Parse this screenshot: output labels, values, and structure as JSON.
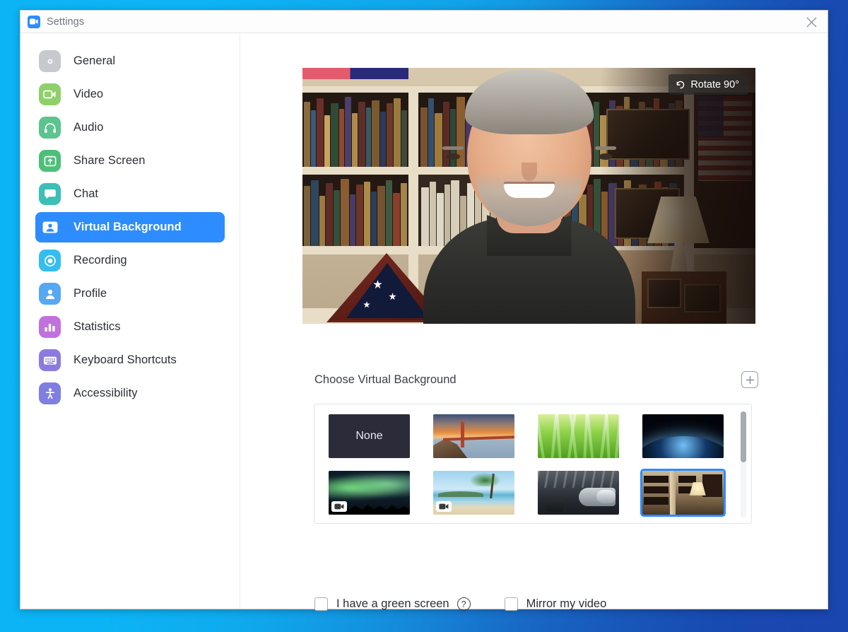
{
  "window": {
    "title": "Settings",
    "logo_icon": "zoom-camera-icon",
    "close_icon": "close-icon"
  },
  "sidebar": {
    "items": [
      {
        "label": "General",
        "icon": "gear-icon",
        "color": "#c6c9cd",
        "active": false
      },
      {
        "label": "Video",
        "icon": "camera-icon",
        "color": "#8fd06a",
        "active": false
      },
      {
        "label": "Audio",
        "icon": "headphones-icon",
        "color": "#5cc48f",
        "active": false
      },
      {
        "label": "Share Screen",
        "icon": "upload-box-icon",
        "color": "#4dbf79",
        "active": false
      },
      {
        "label": "Chat",
        "icon": "chat-bubble-icon",
        "color": "#3bbfb6",
        "active": false
      },
      {
        "label": "Virtual Background",
        "icon": "person-card-icon",
        "color": "#2d8cff",
        "active": true
      },
      {
        "label": "Recording",
        "icon": "record-icon",
        "color": "#35bdf0",
        "active": false
      },
      {
        "label": "Profile",
        "icon": "person-icon",
        "color": "#56a8f2",
        "active": false
      },
      {
        "label": "Statistics",
        "icon": "bar-chart-icon",
        "color": "#c171dd",
        "active": false
      },
      {
        "label": "Keyboard Shortcuts",
        "icon": "keyboard-icon",
        "color": "#8b7bdf",
        "active": false
      },
      {
        "label": "Accessibility",
        "icon": "accessibility-icon",
        "color": "#7e7fe0",
        "active": false
      }
    ]
  },
  "preview": {
    "rotate_button_label": "Rotate 90°",
    "rotate_icon": "rotate-ccw-icon"
  },
  "backgrounds": {
    "heading": "Choose Virtual Background",
    "add_button_icon": "plus-icon",
    "items": [
      {
        "name": "None",
        "type": "none",
        "selected": false,
        "video": false
      },
      {
        "name": "Golden Gate Bridge",
        "type": "bridge",
        "selected": false,
        "video": false
      },
      {
        "name": "Grass",
        "type": "grass",
        "selected": false,
        "video": false
      },
      {
        "name": "Earth from Space",
        "type": "earth",
        "selected": false,
        "video": false
      },
      {
        "name": "Aurora Borealis",
        "type": "aurora",
        "selected": false,
        "video": true
      },
      {
        "name": "Tropical Beach",
        "type": "beach",
        "selected": false,
        "video": true
      },
      {
        "name": "Spaceship Interior",
        "type": "space",
        "selected": false,
        "video": false
      },
      {
        "name": "Home Library",
        "type": "library",
        "selected": true,
        "video": false
      }
    ]
  },
  "options": {
    "green_screen_label": "I have a green screen",
    "green_screen_checked": false,
    "help_glyph": "?",
    "mirror_label": "Mirror my video",
    "mirror_checked": false
  },
  "colors": {
    "accent": "#2d8cff",
    "text": "#2b2f36",
    "muted": "#6f7580",
    "panel_border": "#e2e4e7",
    "desktop_blue_left": "#0cb4f5",
    "desktop_blue_right": "#1a46af"
  }
}
